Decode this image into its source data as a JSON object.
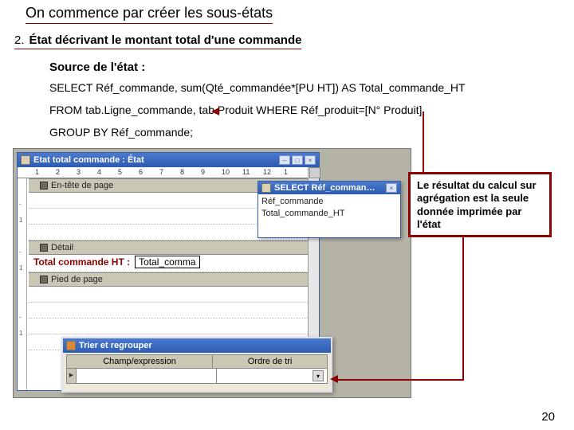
{
  "page": {
    "title": "On commence par créer les sous-états",
    "subtitle_num": "2.",
    "subtitle": "État décrivant le montant total d'une commande",
    "source_label": "Source  de l'état :",
    "sql_line1": "SELECT Réf_commande, sum(Qté_commandée*[PU HT]) AS Total_commande_HT",
    "sql_line2": "FROM tab.Ligne_commande, tab.Produit WHERE Réf_produit=[N° Produit]",
    "sql_line3": "GROUP BY Réf_commande;",
    "page_number": "20"
  },
  "designer": {
    "window_title": "Etat total commande : État",
    "ruler_marks": [
      "1",
      "2",
      "3",
      "4",
      "5",
      "6",
      "7",
      "8",
      "9",
      "10",
      "11",
      "12",
      "1"
    ],
    "section_header": "En-tête de page",
    "section_detail": "Détail",
    "section_footer": "Pied de page",
    "detail_label": "Total commande HT :",
    "detail_value": "Total_comma"
  },
  "fieldlist": {
    "window_title": "SELECT Réf_comman…",
    "btn_close": "×",
    "fields": [
      "Réf_commande",
      "Total_commande_HT"
    ]
  },
  "sortdlg": {
    "title": "Trier et regrouper",
    "col_expr": "Champ/expression",
    "col_order": "Ordre de tri"
  },
  "callout": {
    "text": "Le résultat du calcul sur agrégation est la seule donnée imprimée par l'état"
  },
  "winbtns": {
    "min": "–",
    "max": "□",
    "close": "×"
  }
}
